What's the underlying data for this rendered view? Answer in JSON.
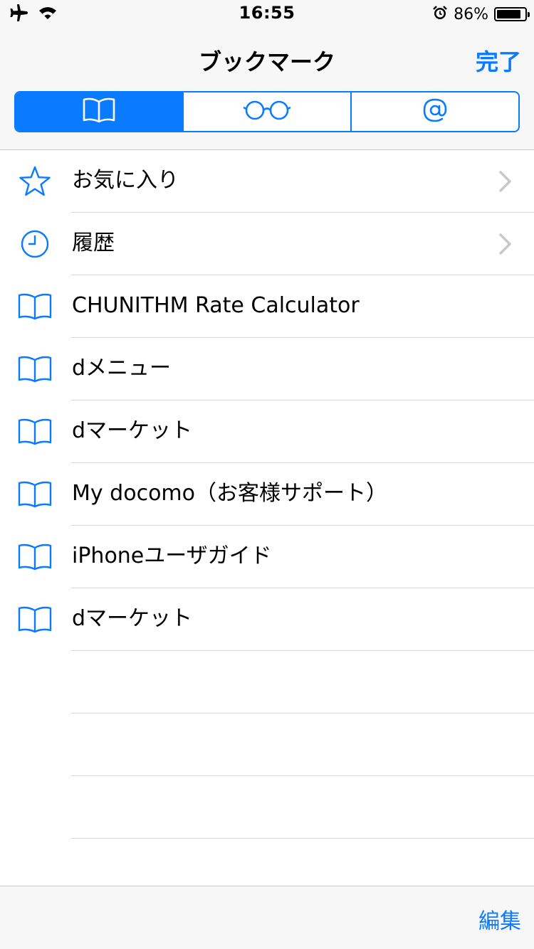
{
  "status_bar": {
    "time": "16:55",
    "battery_percent": "86%",
    "battery_level": 0.86,
    "left_icons": [
      "airplane-icon",
      "wifi-icon"
    ],
    "right_icons": [
      "alarm-icon",
      "battery-icon"
    ]
  },
  "nav": {
    "title": "ブックマーク",
    "done_label": "完了"
  },
  "segments": [
    {
      "icon": "bookmarks-book-icon",
      "selected": true
    },
    {
      "icon": "reading-list-glasses-icon",
      "selected": false
    },
    {
      "icon": "shared-links-at-icon",
      "selected": false
    }
  ],
  "bookmarks": {
    "items": [
      {
        "label": "お気に入り",
        "icon": "star-icon",
        "has_chevron": true
      },
      {
        "label": "履歴",
        "icon": "clock-icon",
        "has_chevron": true
      },
      {
        "label": "CHUNITHM Rate Calculator",
        "icon": "book-icon",
        "has_chevron": false
      },
      {
        "label": "dメニュー",
        "icon": "book-icon",
        "has_chevron": false
      },
      {
        "label": "dマーケット",
        "icon": "book-icon",
        "has_chevron": false
      },
      {
        "label": "My docomo（お客様サポート）",
        "icon": "book-icon",
        "has_chevron": false
      },
      {
        "label": "iPhoneユーザガイド",
        "icon": "book-icon",
        "has_chevron": false
      },
      {
        "label": "dマーケット",
        "icon": "book-icon",
        "has_chevron": false
      }
    ]
  },
  "toolbar": {
    "edit_label": "編集"
  },
  "colors": {
    "accent": "#0a7aff",
    "bar_background": "#f7f7f7",
    "separator": "#d9d9dd"
  }
}
